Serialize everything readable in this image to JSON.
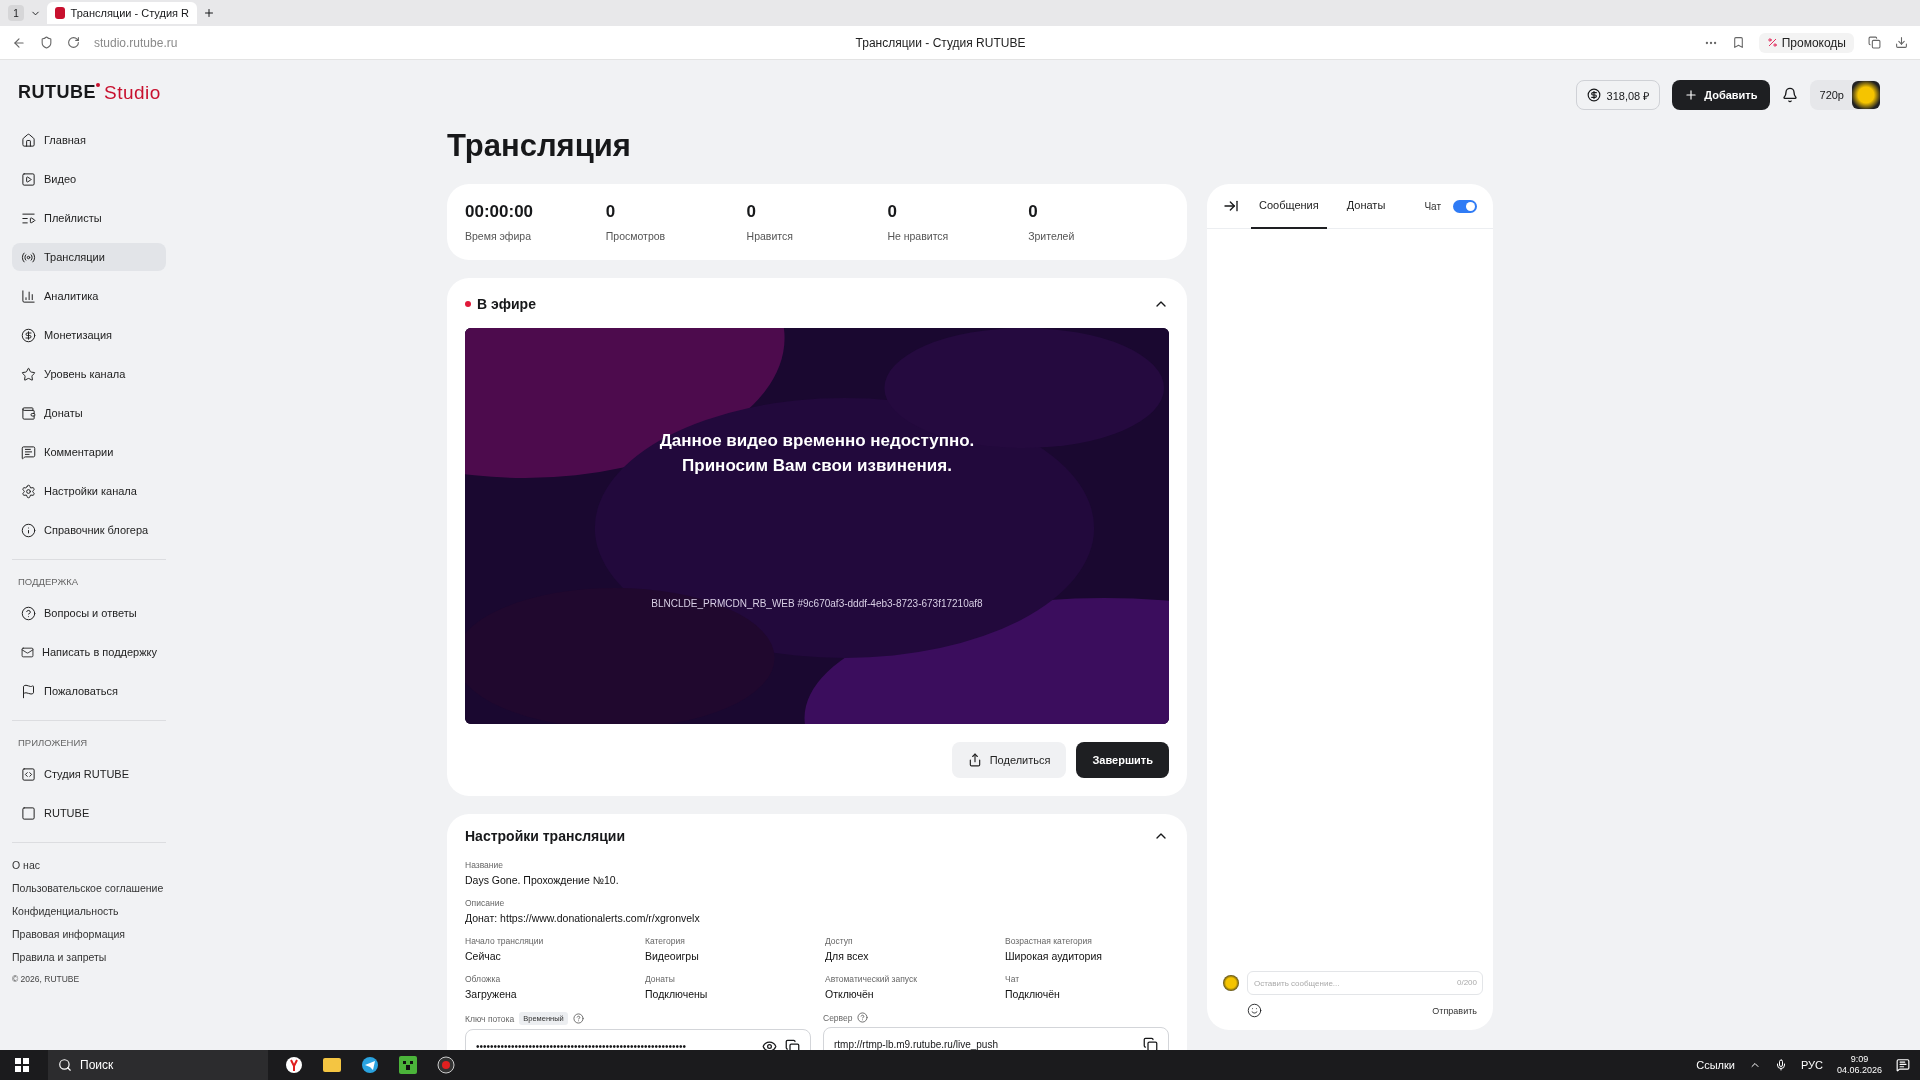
{
  "browser": {
    "tab_count": "1",
    "tabs": [
      {
        "title": "Трансляции - Студия R",
        "selected": true
      }
    ],
    "url": "studio.rutube.ru",
    "page_title": "Трансляции - Студия RUTUBE",
    "promo": "Промокоды"
  },
  "header": {
    "logo_main": "RUTUBE",
    "logo_sub": "Studio",
    "balance": "318,08 ₽",
    "add_button": "Добавить",
    "quality": "720p"
  },
  "sidebar": {
    "items": [
      {
        "label": "Главная",
        "selected": false
      },
      {
        "label": "Видео",
        "selected": false
      },
      {
        "label": "Плейлисты",
        "selected": false
      },
      {
        "label": "Трансляции",
        "selected": true
      },
      {
        "label": "Аналитика",
        "selected": false
      },
      {
        "label": "Монетизация",
        "selected": false
      },
      {
        "label": "Уровень канала",
        "selected": false
      },
      {
        "label": "Донаты",
        "selected": false
      },
      {
        "label": "Комментарии",
        "selected": false
      },
      {
        "label": "Настройки канала",
        "selected": false
      },
      {
        "label": "Справочник блогера",
        "selected": false
      }
    ],
    "support_title": "ПОДДЕРЖКА",
    "support_items": [
      {
        "label": "Вопросы и ответы",
        "selected": false
      },
      {
        "label": "Написать в поддержку",
        "selected": false
      },
      {
        "label": "Пожаловаться",
        "selected": false
      }
    ],
    "apps_title": "ПРИЛОЖЕНИЯ",
    "app_items": [
      {
        "label": "Студия RUTUBE",
        "selected": false
      },
      {
        "label": "RUTUBE",
        "selected": false
      }
    ],
    "footer_links": [
      "О нас",
      "Пользовательское соглашение",
      "Конфиденциальность",
      "Правовая информация",
      "Правила и запреты"
    ],
    "copyright": "© 2026, RUTUBE"
  },
  "page_title": "Трансляция",
  "stats": [
    {
      "value": "00:00:00",
      "label": "Время эфира"
    },
    {
      "value": "0",
      "label": "Просмотров"
    },
    {
      "value": "0",
      "label": "Нравится"
    },
    {
      "value": "0",
      "label": "Не нравится"
    },
    {
      "value": "0",
      "label": "Зрителей"
    }
  ],
  "live": {
    "status": "В эфире",
    "expanded": true,
    "message_lines": [
      "Данное видео временно недоступно.",
      "Приносим Вам свои извинения."
    ],
    "error_code": "BLNCLDE_PRMCDN_RB_WEB #9c670af3-dddf-4eb3-8723-673f17210af8",
    "share_button": "Поделиться",
    "finish_button": "Завершить"
  },
  "settings": {
    "title": "Настройки трансляции",
    "expanded": true,
    "wide_fields": [
      {
        "label": "Название",
        "value": "Days Gone. Прохождение №10."
      },
      {
        "label": "Описание",
        "value": "Донат: https://www.donationalerts.com/r/xgronvelx"
      }
    ],
    "fields": [
      {
        "label": "Начало трансляции",
        "value": "Сейчас"
      },
      {
        "label": "Категория",
        "value": "Видеоигры"
      },
      {
        "label": "Доступ",
        "value": "Для всех"
      },
      {
        "label": "Возрастная категория",
        "value": "Широкая аудитория"
      },
      {
        "label": "Обложка",
        "value": "Загружена"
      },
      {
        "label": "Донаты",
        "value": "Подключены"
      },
      {
        "label": "Автоматический запуск",
        "value": "Отключён"
      },
      {
        "label": "Чат",
        "value": "Подключён"
      }
    ],
    "stream_key": {
      "label": "Ключ потока",
      "badge": "Временный",
      "value": "••••••••••••••••••••••••••••••••••••••••••••••••••••••••••••"
    },
    "server": {
      "label": "Сервер",
      "value": "rtmp://rtmp-lb.m9.rutube.ru/live_push"
    }
  },
  "chat": {
    "tabs": [
      {
        "label": "Сообщения",
        "selected": true
      },
      {
        "label": "Донаты",
        "selected": false
      }
    ],
    "toggle_label": "Чат",
    "chat_on": true,
    "placeholder": "Оставить сообщение...",
    "counter": "0/200",
    "send": "Отправить"
  },
  "taskbar": {
    "search": "Поиск",
    "links": "Ссылки",
    "lang": "РУС",
    "time": "9:09",
    "date": "04.06.2026"
  }
}
